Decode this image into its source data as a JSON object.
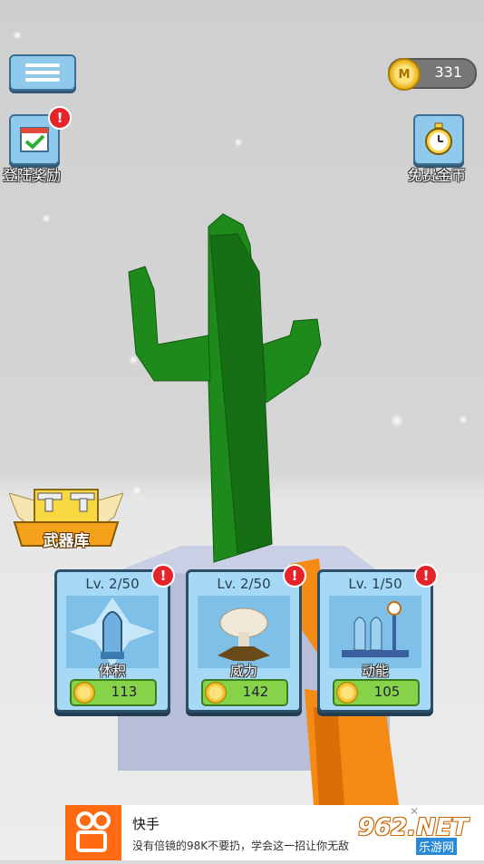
{
  "hud": {
    "coin_count": "331",
    "coin_letter": "M",
    "login_reward_label": "登陆奖励",
    "free_coins_label": "免费金币",
    "alert_mark": "!"
  },
  "armory": {
    "label": "武器库"
  },
  "upgrades": [
    {
      "level": "Lv. 2/50",
      "name": "体积",
      "price": "113",
      "icon": "bullet-icon"
    },
    {
      "level": "Lv. 2/50",
      "name": "威力",
      "price": "142",
      "icon": "explosion-icon"
    },
    {
      "level": "Lv. 1/50",
      "name": "动能",
      "price": "105",
      "icon": "gauge-icon"
    }
  ],
  "ad": {
    "title": "快手",
    "text": "没有倍镜的98K不要扔，学会这一招让你无敌",
    "close": "✕"
  },
  "watermark": {
    "number": "962.NET",
    "sub": "乐游网"
  },
  "colors": {
    "cactus": "#1f8a1c",
    "button_blue": "#8fc9ec",
    "price_green": "#86d34a",
    "alert_red": "#e4242a",
    "gun_orange": "#f58a14"
  }
}
